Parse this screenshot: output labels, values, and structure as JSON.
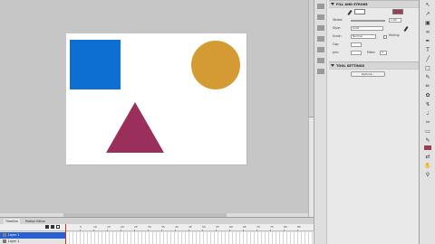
{
  "colors": {
    "shape_blue": "#0c6fd1",
    "shape_orange": "#d49a34",
    "shape_purple": "#9a2f5c",
    "stroke_swatch": "#ffffff",
    "fill_swatch": "#9a3d55",
    "selected_layer": "#2a5fcf",
    "playhead": "#d62a2a"
  },
  "properties": {
    "fill_and_stroke": {
      "title": "FILL AND STROKE",
      "stroke_label": "Stroke:",
      "stroke_value": "1.00",
      "style_label": "Style:",
      "style_value": "Solid",
      "scale_label": "Scale:",
      "scale_value": "Normal",
      "hinting_label": "Hinting",
      "cap_label": "Cap:",
      "join_label": "Join:",
      "miter_label": "Miter:",
      "miter_value": "3"
    },
    "tool_settings": {
      "title": "TOOL SETTINGS",
      "options_button": "Options..."
    }
  },
  "timeline": {
    "tabs": [
      "Timeline",
      "Motion Editor"
    ],
    "layers": [
      "Layer 1",
      "Layer 1"
    ],
    "frame_numbers": [
      "5",
      "10",
      "15",
      "20",
      "25",
      "30",
      "35",
      "40",
      "45",
      "50",
      "55",
      "60",
      "65",
      "70",
      "75",
      "80",
      "85"
    ]
  },
  "tools": {
    "icons": [
      "selection-icon",
      "subselection-icon",
      "free-transform-icon",
      "lasso-icon",
      "pen-icon",
      "text-icon",
      "line-icon",
      "rectangle-icon",
      "pencil-icon",
      "brush-icon",
      "deco-icon",
      "bone-icon",
      "paint-bucket-icon",
      "eyedropper-icon",
      "eraser-icon",
      "hand-icon",
      "zoom-icon",
      "stroke-color-icon",
      "fill-color-icon",
      "swap-colors-icon",
      "snap-icon"
    ]
  }
}
